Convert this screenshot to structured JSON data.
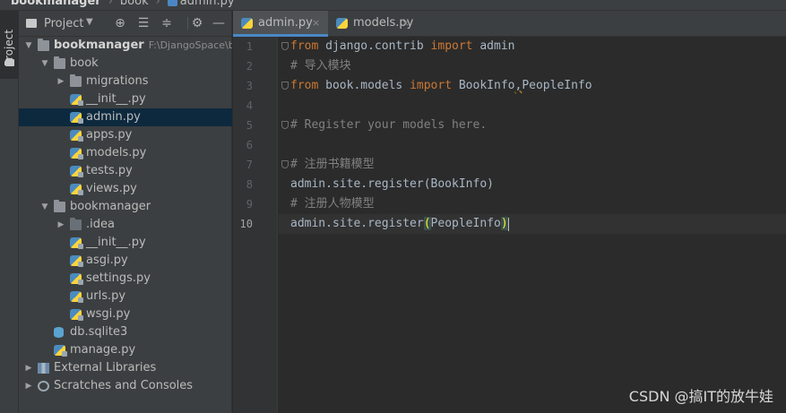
{
  "breadcrumb": {
    "project": "bookmanager",
    "folder": "book",
    "file": "admin.py"
  },
  "side_strip": {
    "label": "Project"
  },
  "project_panel": {
    "title": "Project",
    "tree": [
      {
        "label": "bookmanager",
        "path": "F:\\DjangoSpace\\b",
        "kind": "folder",
        "depth": 0,
        "expanded": true
      },
      {
        "label": "book",
        "kind": "folder",
        "depth": 1,
        "expanded": true
      },
      {
        "label": "migrations",
        "kind": "folder",
        "depth": 2,
        "expanded": false
      },
      {
        "label": "__init__.py",
        "kind": "py",
        "depth": 2
      },
      {
        "label": "admin.py",
        "kind": "py",
        "depth": 2,
        "selected": true
      },
      {
        "label": "apps.py",
        "kind": "py",
        "depth": 2
      },
      {
        "label": "models.py",
        "kind": "py",
        "depth": 2
      },
      {
        "label": "tests.py",
        "kind": "py",
        "depth": 2
      },
      {
        "label": "views.py",
        "kind": "py",
        "depth": 2
      },
      {
        "label": "bookmanager",
        "kind": "folder",
        "depth": 1,
        "expanded": true
      },
      {
        "label": ".idea",
        "kind": "folder-dim",
        "depth": 2,
        "expanded": false
      },
      {
        "label": "__init__.py",
        "kind": "py",
        "depth": 2
      },
      {
        "label": "asgi.py",
        "kind": "py",
        "depth": 2
      },
      {
        "label": "settings.py",
        "kind": "py",
        "depth": 2
      },
      {
        "label": "urls.py",
        "kind": "py",
        "depth": 2
      },
      {
        "label": "wsgi.py",
        "kind": "py",
        "depth": 2
      },
      {
        "label": "db.sqlite3",
        "kind": "db",
        "depth": 1
      },
      {
        "label": "manage.py",
        "kind": "py",
        "depth": 1
      },
      {
        "label": "External Libraries",
        "kind": "libs",
        "depth": 0,
        "expanded": false
      },
      {
        "label": "Scratches and Consoles",
        "kind": "scratch",
        "depth": 0,
        "expanded": false
      }
    ]
  },
  "tabs": [
    {
      "label": "admin.py",
      "active": true,
      "close": "×"
    },
    {
      "label": "models.py",
      "active": false,
      "close": "×"
    }
  ],
  "editor": {
    "current_line": 10,
    "lines": [
      {
        "n": "1",
        "fold": true,
        "tokens": [
          {
            "t": "from",
            "c": "kw"
          },
          {
            "t": " django.contrib ",
            "c": "plain"
          },
          {
            "t": "import",
            "c": "kw"
          },
          {
            "t": " admin",
            "c": "plain"
          }
        ]
      },
      {
        "n": "2",
        "tokens": [
          {
            "t": "# 导入模块",
            "c": "cm"
          }
        ]
      },
      {
        "n": "3",
        "fold": true,
        "tokens": [
          {
            "t": "from",
            "c": "kw"
          },
          {
            "t": " book.models ",
            "c": "plain"
          },
          {
            "t": "import",
            "c": "kw"
          },
          {
            "t": " BookInfo",
            "c": "plain"
          },
          {
            "t": ",",
            "c": "plain warn"
          },
          {
            "t": "PeopleInfo",
            "c": "plain"
          }
        ]
      },
      {
        "n": "4",
        "tokens": []
      },
      {
        "n": "5",
        "fold": true,
        "tokens": [
          {
            "t": "# Register your models here.",
            "c": "cm"
          }
        ]
      },
      {
        "n": "6",
        "tokens": []
      },
      {
        "n": "7",
        "fold": true,
        "tokens": [
          {
            "t": "# 注册书籍模型",
            "c": "cm"
          }
        ]
      },
      {
        "n": "8",
        "tokens": [
          {
            "t": "admin.site.register(BookInfo)",
            "c": "plain"
          }
        ]
      },
      {
        "n": "9",
        "tokens": [
          {
            "t": "# 注册人物模型",
            "c": "cm"
          }
        ]
      },
      {
        "n": "10",
        "tokens": [
          {
            "t": "admin.site.register",
            "c": "plain"
          },
          {
            "t": "(",
            "c": "hl"
          },
          {
            "t": "PeopleInfo",
            "c": "plain"
          },
          {
            "t": ")",
            "c": "hl"
          }
        ]
      }
    ]
  },
  "watermark": "CSDN @搞IT的放牛娃",
  "colors": {
    "keyword": "#cc7832",
    "comment": "#808080",
    "text": "#a9b7c6",
    "selection": "#0d293e",
    "accent": "#4a88c7"
  }
}
